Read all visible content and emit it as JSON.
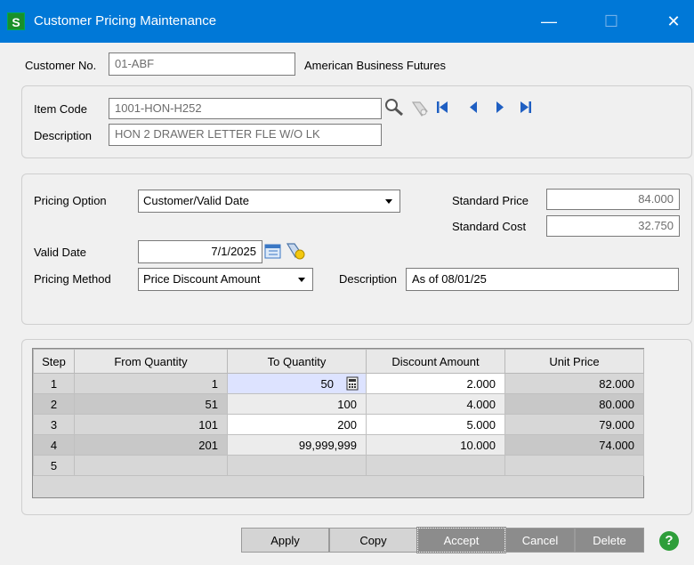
{
  "window": {
    "title": "Customer Pricing Maintenance",
    "app_icon_letter": "S",
    "minimize": "—",
    "maximize": "☐",
    "close": "✕"
  },
  "customer": {
    "label": "Customer No.",
    "value": "01-ABF",
    "name": "American Business Futures"
  },
  "item": {
    "code_label": "Item Code",
    "code_value": "1001-HON-H252",
    "desc_label": "Description",
    "desc_value": "HON 2 DRAWER LETTER FLE W/O LK"
  },
  "pricing": {
    "option_label": "Pricing Option",
    "option_value": "Customer/Valid Date",
    "std_price_label": "Standard Price",
    "std_price_value": "84.000",
    "std_cost_label": "Standard Cost",
    "std_cost_value": "32.750",
    "valid_date_label": "Valid Date",
    "valid_date_value": "7/1/2025",
    "method_label": "Pricing Method",
    "method_value": "Price Discount Amount",
    "desc_label": "Description",
    "desc_value": "As of 08/01/25"
  },
  "grid": {
    "headers": [
      "Step",
      "From Quantity",
      "To Quantity",
      "Discount Amount",
      "Unit Price"
    ],
    "rows": [
      [
        "1",
        "1",
        "50",
        "2.000",
        "82.000"
      ],
      [
        "2",
        "51",
        "100",
        "4.000",
        "80.000"
      ],
      [
        "3",
        "101",
        "200",
        "5.000",
        "79.000"
      ],
      [
        "4",
        "201",
        "99,999,999",
        "10.000",
        "74.000"
      ],
      [
        "5",
        "",
        "",
        "",
        ""
      ]
    ]
  },
  "buttons": {
    "apply": "Apply",
    "copy": "Copy",
    "accept": "Accept",
    "cancel": "Cancel",
    "delete": "Delete",
    "help": "?"
  },
  "colors": {
    "titlebar": "#0078d7",
    "selected_cell": "#dde3ff",
    "dark_button": "#8c8c8c"
  }
}
